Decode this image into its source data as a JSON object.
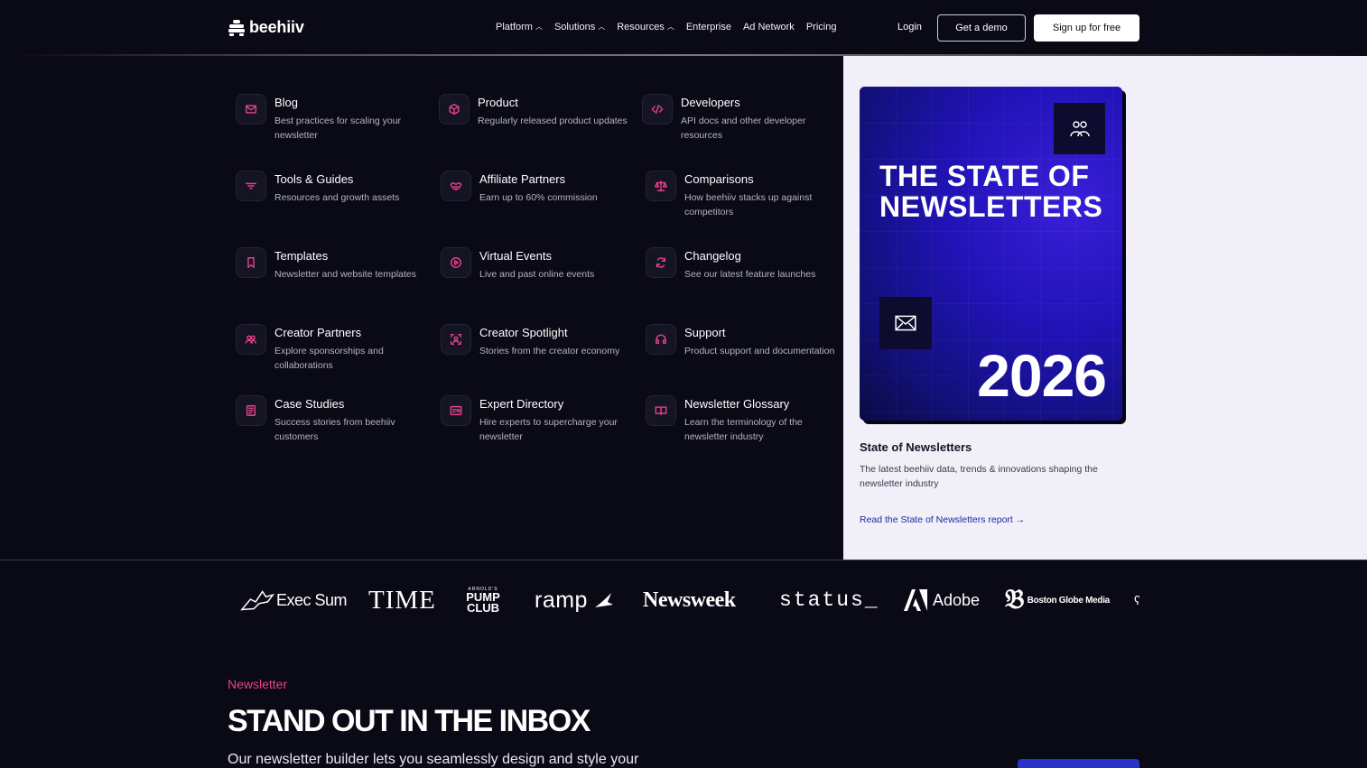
{
  "header": {
    "logo_text": "beehiiv",
    "nav": [
      {
        "label": "Platform",
        "has_menu": true
      },
      {
        "label": "Solutions",
        "has_menu": true
      },
      {
        "label": "Resources",
        "has_menu": true
      },
      {
        "label": "Enterprise",
        "has_menu": false
      },
      {
        "label": "Ad Network",
        "has_menu": false
      },
      {
        "label": "Pricing",
        "has_menu": false
      }
    ],
    "login": "Login",
    "demo": "Get a demo",
    "signup": "Sign up for free"
  },
  "menu": {
    "items": [
      {
        "title": "Blog",
        "desc": "Best practices for scaling your newsletter",
        "icon": "mail-icon"
      },
      {
        "title": "Product",
        "desc": "Regularly released product updates",
        "icon": "box-icon"
      },
      {
        "title": "Developers",
        "desc": "API docs and other developer resources",
        "icon": "code-icon"
      },
      {
        "title": "Tools & Guides",
        "desc": "Resources and growth assets",
        "icon": "filter-icon"
      },
      {
        "title": "Affiliate Partners",
        "desc": "Earn up to 60% commission",
        "icon": "handshake-icon"
      },
      {
        "title": "Comparisons",
        "desc": "How beehiiv stacks up against competitors",
        "icon": "scale-icon"
      },
      {
        "title": "Templates",
        "desc": "Newsletter and website templates",
        "icon": "bookmark-icon"
      },
      {
        "title": "Virtual Events",
        "desc": "Live and past online events",
        "icon": "play-icon"
      },
      {
        "title": "Changelog",
        "desc": "See our latest feature launches",
        "icon": "refresh-icon"
      },
      {
        "title": "Creator Partners",
        "desc": "Explore sponsorships and collaborations",
        "icon": "users-icon"
      },
      {
        "title": "Creator Spotlight",
        "desc": "Stories from the creator economy",
        "icon": "focus-user-icon"
      },
      {
        "title": "Support",
        "desc": "Product support and documentation",
        "icon": "headset-icon"
      },
      {
        "title": "Case Studies",
        "desc": "Success stories from beehiiv customers",
        "icon": "document-icon"
      },
      {
        "title": "Expert Directory",
        "desc": "Hire experts to supercharge your newsletter",
        "icon": "id-card-icon"
      },
      {
        "title": "Newsletter Glossary",
        "desc": "Learn the terminology of the newsletter industry",
        "icon": "book-icon"
      }
    ]
  },
  "promo": {
    "image_title": "THE STATE OF NEWSLETTERS",
    "image_year": "2026",
    "heading": "State of Newsletters",
    "desc": "The latest beehiiv data, trends & innovations shaping the newsletter industry",
    "link": "Read the State of Newsletters report →"
  },
  "logos": [
    "Exec Sum",
    "TIME",
    "PUMP CLUB",
    "ramp",
    "Newsweek",
    "status_",
    "Adobe",
    "Boston Globe Media"
  ],
  "logo_pump_small": "ARNOLD'S",
  "newsletter": {
    "eyebrow": "Newsletter",
    "title": "STAND OUT IN THE INBOX",
    "subtitle": "Our newsletter builder lets you seamlessly design and style your"
  },
  "colors": {
    "accent": "#e6428a",
    "background": "#0a0916",
    "panel": "#f1eff7",
    "link": "#1c2aa8"
  }
}
